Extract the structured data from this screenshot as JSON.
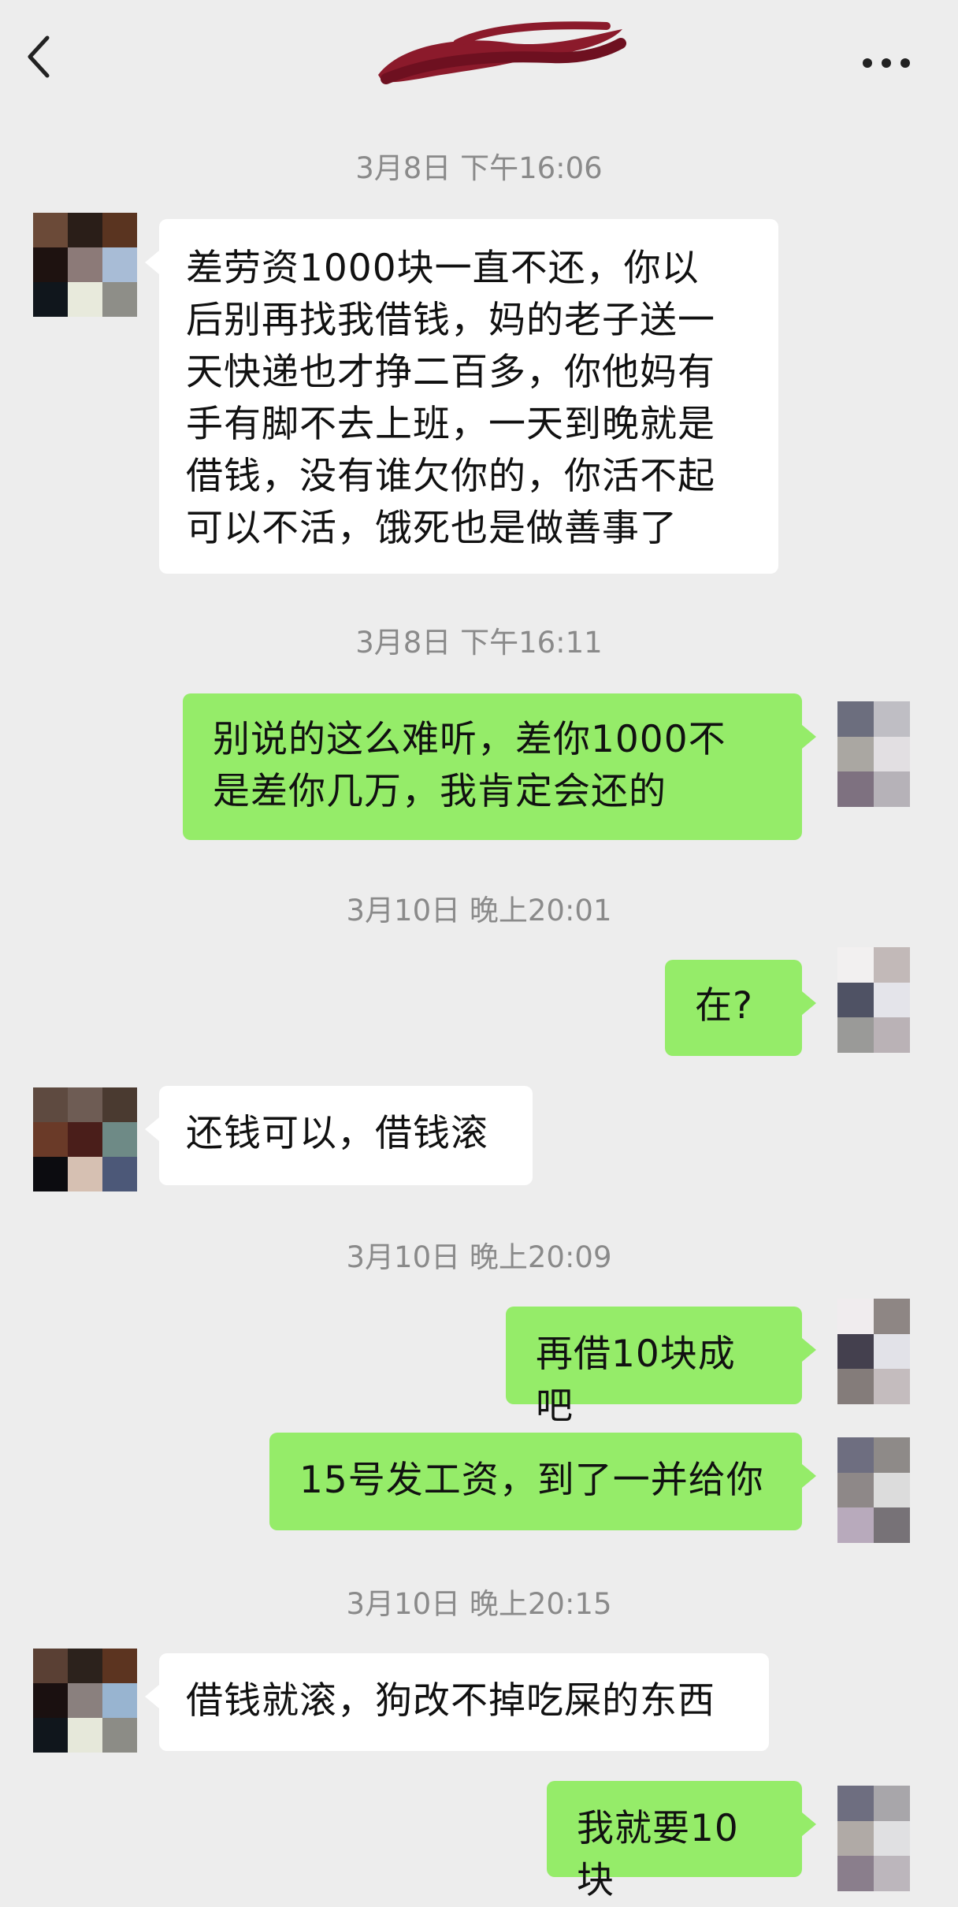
{
  "header": {
    "back_icon": "chevron-left-icon",
    "more_icon": "ellipsis-icon",
    "title_redaction": "red scribble over contact name"
  },
  "colors": {
    "background": "#ededed",
    "incoming_bubble": "#ffffff",
    "outgoing_bubble": "#95ec69",
    "timestamp": "#8a8a8a",
    "redaction": "#8b1a2b"
  },
  "messages": {
    "ts1": "3月8日 下午16:06",
    "m1": "差劳资1000块一直不还，你以\n后别再找我借钱，妈的老子送一\n天快递也才挣二百多，你他妈有\n手有脚不去上班，一天到晚就是\n借钱，没有谁欠你的，你活不起\n可以不活，饿死也是做善事了",
    "ts2": "3月8日 下午16:11",
    "m2": "别说的这么难听，差你1000不\n是差你几万，我肯定会还的",
    "ts3": "3月10日 晚上20:01",
    "m3": "在?",
    "m4": "还钱可以，借钱滚",
    "ts4": "3月10日 晚上20:09",
    "m5": "再借10块成吧",
    "m6": "15号发工资，到了一并给你",
    "ts5": "3月10日 晚上20:15",
    "m7": "借钱就滚，狗改不掉吃屎的东西",
    "m8": "我就要10块"
  }
}
